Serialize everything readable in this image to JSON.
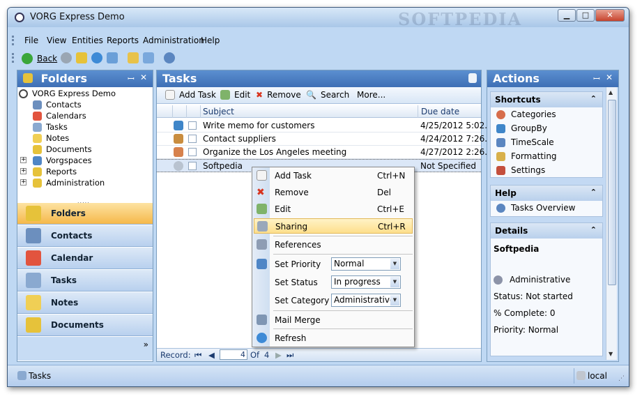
{
  "window": {
    "title": "VORG Express Demo",
    "watermark": "SOFTPEDIA",
    "minimize": "▁",
    "maximize": "□",
    "close": "✕"
  },
  "menu": [
    "File",
    "View",
    "Entities",
    "Reports",
    "Administration",
    "Help"
  ],
  "toolbar": {
    "back_label": "Back"
  },
  "folders": {
    "title": "Folders",
    "pin": "ꟷ",
    "close": "✕",
    "tree": [
      {
        "label": "VORG Express Demo",
        "icon": "vorg-icon"
      },
      {
        "label": "Contacts",
        "icon": "contacts-icon"
      },
      {
        "label": "Calendars",
        "icon": "calendar-icon"
      },
      {
        "label": "Tasks",
        "icon": "tasks-icon"
      },
      {
        "label": "Notes",
        "icon": "notes-icon"
      },
      {
        "label": "Documents",
        "icon": "folder-icon"
      },
      {
        "label": "Vorgspaces",
        "icon": "vorgspaces-icon"
      },
      {
        "label": "Reports",
        "icon": "folder-icon"
      },
      {
        "label": "Administration",
        "icon": "folder-icon"
      }
    ],
    "splitter": ".....",
    "nav_buttons": [
      "Folders",
      "Contacts",
      "Calendar",
      "Tasks",
      "Notes",
      "Documents"
    ],
    "nav_more": "»"
  },
  "tasks": {
    "title": "Tasks",
    "toolbar": {
      "add": "Add Task",
      "edit": "Edit",
      "remove": "Remove",
      "search": "Search",
      "more": "More..."
    },
    "columns": {
      "subject": "Subject",
      "due": "Due date"
    },
    "rows": [
      {
        "subject": "Write memo for customers",
        "due": "4/25/2012  5:02...",
        "icon": "memo-task-icon"
      },
      {
        "subject": "Contact suppliers",
        "due": "4/24/2012  7:26...",
        "icon": "money-task-icon"
      },
      {
        "subject": "Organize the Los Angeles meeting",
        "due": "4/27/2012  2:26...",
        "icon": "meeting-task-icon"
      },
      {
        "subject": "Softpedia",
        "due": "Not Specified",
        "icon": "generic-task-icon"
      }
    ],
    "record_bar": {
      "label": "Record:",
      "current": "4",
      "of": "Of",
      "total": "4"
    }
  },
  "context_menu": {
    "items": [
      {
        "label": "Add Task",
        "shortcut": "Ctrl+N",
        "icon": "add-task-icon"
      },
      {
        "label": "Remove",
        "shortcut": "Del",
        "icon": "remove-icon"
      },
      {
        "label": "Edit",
        "shortcut": "Ctrl+E",
        "icon": "edit-icon"
      },
      {
        "label": "Sharing",
        "shortcut": "Ctrl+R",
        "icon": "sharing-icon"
      },
      {
        "label": "References",
        "shortcut": "",
        "icon": "references-icon"
      },
      {
        "label": "Set Priority",
        "value": "Normal",
        "icon": "priority-icon"
      },
      {
        "label": "Set Status",
        "value": "In progress",
        "icon": ""
      },
      {
        "label": "Set Category",
        "value": "Administrative",
        "icon": ""
      },
      {
        "label": "Mail Merge",
        "shortcut": "",
        "icon": "mail-merge-icon"
      },
      {
        "label": "Refresh",
        "shortcut": "",
        "icon": "refresh-icon"
      }
    ],
    "highlighted": "Sharing"
  },
  "actions": {
    "title": "Actions",
    "shortcuts": {
      "title": "Shortcuts",
      "items": [
        "Categories",
        "GroupBy",
        "TimeScale",
        "Formatting",
        "Settings"
      ]
    },
    "help": {
      "title": "Help",
      "items": [
        "Tasks Overview"
      ]
    },
    "details": {
      "title": "Details",
      "name": "Softpedia",
      "category": "Administrative",
      "status": "Status: Not started",
      "complete": "% Complete: 0",
      "priority": "Priority: Normal"
    }
  },
  "statusbar": {
    "left": "Tasks",
    "right": "local"
  },
  "colors": {
    "header_blue": "#3e6fb5",
    "active_nav": "#f5b84a",
    "highlight": "#fddf8c"
  }
}
